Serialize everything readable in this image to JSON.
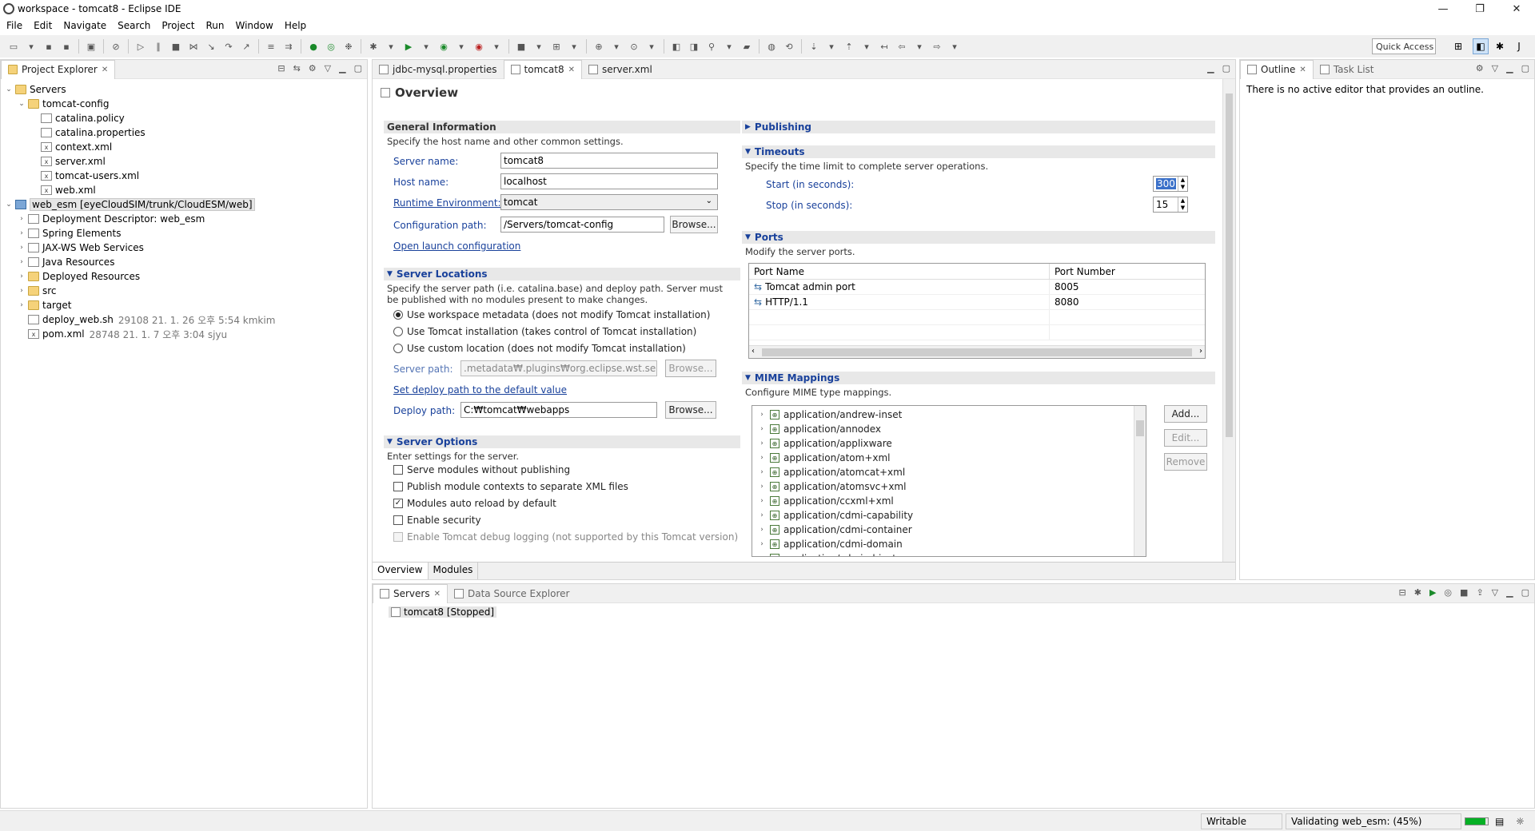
{
  "window": {
    "title": "workspace - tomcat8 - Eclipse IDE",
    "minimize": "—",
    "maximize": "❐",
    "close": "✕"
  },
  "menu": [
    "File",
    "Edit",
    "Navigate",
    "Search",
    "Project",
    "Run",
    "Window",
    "Help"
  ],
  "toolbar": {
    "quick_access": "Quick Access"
  },
  "project_explorer": {
    "tab": "Project Explorer",
    "tree": [
      {
        "label": "Servers",
        "level": 0,
        "twisty": "open",
        "icon": "folder"
      },
      {
        "label": "tomcat-config",
        "level": 1,
        "twisty": "open",
        "icon": "folder"
      },
      {
        "label": "catalina.policy",
        "level": 2,
        "twisty": "",
        "icon": "file"
      },
      {
        "label": "catalina.properties",
        "level": 2,
        "twisty": "",
        "icon": "file"
      },
      {
        "label": "context.xml",
        "level": 2,
        "twisty": "",
        "icon": "xml"
      },
      {
        "label": "server.xml",
        "level": 2,
        "twisty": "",
        "icon": "xml"
      },
      {
        "label": "tomcat-users.xml",
        "level": 2,
        "twisty": "",
        "icon": "xml"
      },
      {
        "label": "web.xml",
        "level": 2,
        "twisty": "",
        "icon": "xml"
      },
      {
        "label": "web_esm [eyeCloudSIM/trunk/CloudESM/web]",
        "level": 0,
        "twisty": "open",
        "icon": "project",
        "selected": true
      },
      {
        "label": "Deployment Descriptor: web_esm",
        "level": 1,
        "twisty": "closed",
        "icon": "file"
      },
      {
        "label": "Spring Elements",
        "level": 1,
        "twisty": "closed",
        "icon": "file"
      },
      {
        "label": "JAX-WS Web Services",
        "level": 1,
        "twisty": "closed",
        "icon": "file"
      },
      {
        "label": "Java Resources",
        "level": 1,
        "twisty": "closed",
        "icon": "file"
      },
      {
        "label": "Deployed Resources",
        "level": 1,
        "twisty": "closed",
        "icon": "folder"
      },
      {
        "label": "src",
        "level": 1,
        "twisty": "closed",
        "icon": "folder"
      },
      {
        "label": "target",
        "level": 1,
        "twisty": "closed",
        "icon": "folder"
      },
      {
        "label": "deploy_web.sh",
        "level": 1,
        "twisty": "",
        "icon": "file",
        "extra": "29108  21. 1. 26 오후 5:54  kmkim"
      },
      {
        "label": "pom.xml",
        "level": 1,
        "twisty": "",
        "icon": "xml",
        "extra": "28748  21. 1. 7 오후 3:04  sjyu"
      }
    ]
  },
  "editor": {
    "tabs": [
      {
        "label": "jdbc-mysql.properties",
        "active": false
      },
      {
        "label": "tomcat8",
        "active": true
      },
      {
        "label": "server.xml",
        "active": false
      }
    ],
    "title": "Overview",
    "general": {
      "header": "General Information",
      "desc": "Specify the host name and other common settings.",
      "server_name_label": "Server name:",
      "server_name": "tomcat8",
      "host_name_label": "Host name:",
      "host_name": "localhost",
      "runtime_label": "Runtime Environment:",
      "runtime": "tomcat",
      "config_path_label": "Configuration path:",
      "config_path": "/Servers/tomcat-config",
      "browse": "Browse...",
      "open_launch": "Open launch configuration"
    },
    "locations": {
      "header": "Server Locations",
      "desc": "Specify the server path (i.e. catalina.base) and deploy path. Server must be published with no modules present to make changes.",
      "opt1": "Use workspace metadata (does not modify Tomcat installation)",
      "opt2": "Use Tomcat installation (takes control of Tomcat installation)",
      "opt3": "Use custom location (does not modify Tomcat installation)",
      "server_path_label": "Server path:",
      "server_path": ".metadata₩.plugins₩org.eclipse.wst.server.cc",
      "browse": "Browse...",
      "set_default": "Set deploy path to the default value",
      "deploy_path_label": "Deploy path:",
      "deploy_path": "C:₩tomcat₩webapps"
    },
    "options": {
      "header": "Server Options",
      "desc": "Enter settings for the server.",
      "items": [
        {
          "label": "Serve modules without publishing",
          "checked": false,
          "disabled": false
        },
        {
          "label": "Publish module contexts to separate XML files",
          "checked": false,
          "disabled": false
        },
        {
          "label": "Modules auto reload by default",
          "checked": true,
          "disabled": false
        },
        {
          "label": "Enable security",
          "checked": false,
          "disabled": false
        },
        {
          "label": "Enable Tomcat debug logging (not supported by this Tomcat version)",
          "checked": false,
          "disabled": true
        }
      ]
    },
    "publishing": {
      "header": "Publishing"
    },
    "timeouts": {
      "header": "Timeouts",
      "desc": "Specify the time limit to complete server operations.",
      "start_label": "Start (in seconds):",
      "start": "300",
      "stop_label": "Stop (in seconds):",
      "stop": "15"
    },
    "ports": {
      "header": "Ports",
      "desc": "Modify the server ports.",
      "col_name": "Port Name",
      "col_number": "Port Number",
      "rows": [
        {
          "name": "Tomcat admin port",
          "number": "8005"
        },
        {
          "name": "HTTP/1.1",
          "number": "8080"
        }
      ]
    },
    "mime": {
      "header": "MIME Mappings",
      "desc": "Configure MIME type mappings.",
      "items": [
        "application/andrew-inset",
        "application/annodex",
        "application/applixware",
        "application/atom+xml",
        "application/atomcat+xml",
        "application/atomsvc+xml",
        "application/ccxml+xml",
        "application/cdmi-capability",
        "application/cdmi-container",
        "application/cdmi-domain",
        "application/cdmi-object"
      ],
      "add": "Add...",
      "edit": "Edit...",
      "remove": "Remove"
    },
    "bottom_tabs": [
      "Overview",
      "Modules"
    ]
  },
  "outline": {
    "tab": "Outline",
    "tab2": "Task List",
    "message": "There is no active editor that provides an outline."
  },
  "servers_view": {
    "tab": "Servers",
    "tab2": "Data Source Explorer",
    "entry": "tomcat8  [Stopped]"
  },
  "status": {
    "writable": "Writable",
    "progress_text": "Validating web_esm: (45%)",
    "progress": 0.45
  }
}
